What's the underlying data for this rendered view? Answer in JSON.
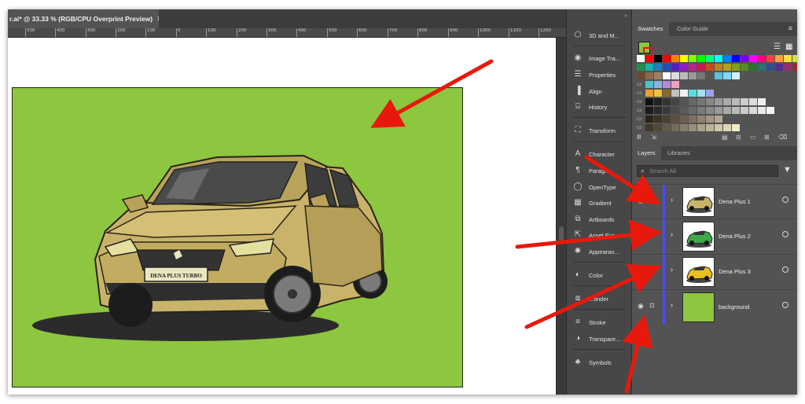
{
  "document": {
    "tab_title": "r.ai* @ 33.33 % (RGB/CPU Overprint Preview)",
    "close_glyph": "×",
    "ruler_ticks": [
      "500",
      "400",
      "300",
      "200",
      "100",
      "0",
      "100",
      "200",
      "300",
      "400",
      "500",
      "600",
      "700",
      "800",
      "900",
      "1000",
      "1100",
      "1200"
    ]
  },
  "artboard": {
    "background_color": "#8dc63f",
    "plate_text": "DENA PLUS TURBO"
  },
  "tools_panel": {
    "items": [
      {
        "label": "3D and M...",
        "icon": "cube-icon"
      },
      {
        "label": "Image Tra...",
        "icon": "image-trace-icon"
      },
      {
        "label": "Properties",
        "icon": "sliders-icon"
      },
      {
        "label": "Align",
        "icon": "align-icon"
      },
      {
        "label": "History",
        "icon": "history-icon"
      },
      {
        "label": "Transform",
        "icon": "transform-icon"
      },
      {
        "label": "Character",
        "icon": "character-icon"
      },
      {
        "label": "Paragr...",
        "icon": "paragraph-icon"
      },
      {
        "label": "OpenType",
        "icon": "opentype-icon"
      },
      {
        "label": "Gradient",
        "icon": "gradient-icon"
      },
      {
        "label": "Artboards",
        "icon": "artboards-icon"
      },
      {
        "label": "Asset Exp...",
        "icon": "asset-export-icon"
      },
      {
        "label": "Appearan...",
        "icon": "appearance-icon"
      },
      {
        "label": "Color",
        "icon": "color-icon"
      },
      {
        "label": "...finder",
        "icon": "pathfinder-icon"
      },
      {
        "label": "Stroke",
        "icon": "stroke-icon"
      },
      {
        "label": "Transpare...",
        "icon": "transparency-icon"
      },
      {
        "label": "Symbols",
        "icon": "symbols-icon"
      }
    ]
  },
  "swatches_panel": {
    "tabs": [
      "Swatches",
      "Color Guide"
    ],
    "active_tab": "Swatches",
    "fill_color": "#8dc63f",
    "rows": [
      [
        "#ffffff",
        "#ff0000",
        "#000000",
        "#ff0000",
        "#ff7f00",
        "#ffff00",
        "#7fff00",
        "#00ff00",
        "#00ff7f",
        "#00ffff",
        "#007fff",
        "#0000ff",
        "#7f00ff",
        "#ff00ff",
        "#ff007f",
        "#ff3f3f",
        "#ff9f3f",
        "#ffdf3f",
        "#cfe33f",
        "#8dc63f",
        "#3fbf7f"
      ],
      [
        "#1f8f4f",
        "#1fafaf",
        "#1f7fbf",
        "#1f4fbf",
        "#4f1fbf",
        "#8f1fbf",
        "#bf1f8f",
        "#bf1f4f",
        "#bf4f1f",
        "#bf7f1f",
        "#af9f1f",
        "#7f9f1f",
        "#4f8f1f",
        "#2f6f2f",
        "#2f6f6f",
        "#2f4f8f",
        "#4f2f8f",
        "#8f2f6f",
        "#8f2f2f",
        "#c8a060",
        "#a07040"
      ],
      [
        "#6a4a2a",
        "#8a6a4a",
        "#a08060",
        "#ffffff",
        "#dddddd",
        "#bbbbbb",
        "#999999",
        "#777777",
        "#555555",
        "#5bc0de",
        "#7fd8ff",
        "#cfefff"
      ],
      [
        "#4fc3c8",
        "#8ab4e0",
        "#b48ae0",
        "#f0a0c0"
      ],
      [
        "#e8a030",
        "#f0c040",
        "#8a6a2a",
        "#c0c0c0",
        "#f0f0f0",
        "#50e0e0",
        "#a0e0f0",
        "#a0a0f0"
      ],
      [
        "#111111",
        "#222222",
        "#333333",
        "#444444",
        "#555555",
        "#666666",
        "#777777",
        "#888888",
        "#999999",
        "#aaaaaa",
        "#bbbbbb",
        "#cccccc",
        "#dddddd",
        "#eeeeee"
      ],
      [
        "#1a1a1a",
        "#2a2a2a",
        "#3a3a3a",
        "#4a4a4a",
        "#5a5a5a",
        "#6a6a6a",
        "#7a7a7a",
        "#8a8a8a",
        "#9a9a9a",
        "#aaaaaa",
        "#bababa",
        "#cacaca",
        "#dadada",
        "#eaeaea",
        "#f5f5f5"
      ],
      [
        "#2a2418",
        "#3a3222",
        "#4a4030",
        "#5c5040",
        "#6e6050",
        "#807060",
        "#928270",
        "#a49480",
        "#b6a690"
      ],
      [
        "#40382a",
        "#524838",
        "#645a48",
        "#766c58",
        "#887e68",
        "#9a9078",
        "#aca288",
        "#beb498",
        "#d0c6a8",
        "#e2d8b8",
        "#f4eac8"
      ]
    ]
  },
  "layers_panel": {
    "tabs": [
      "Layers",
      "Libraries"
    ],
    "active_tab": "Layers",
    "search_placeholder": "Search All",
    "layers": [
      {
        "name": "Dena Plus 1",
        "visible": true,
        "car_color": "#c8b468"
      },
      {
        "name": "Dena Plus 2",
        "visible": false,
        "car_color": "#3fa84a"
      },
      {
        "name": "Dena Plus 3",
        "visible": false,
        "car_color": "#e8c020"
      },
      {
        "name": "background",
        "visible": true,
        "car_color": "#8dc63f"
      }
    ]
  },
  "annotation_color": "#e8190c"
}
